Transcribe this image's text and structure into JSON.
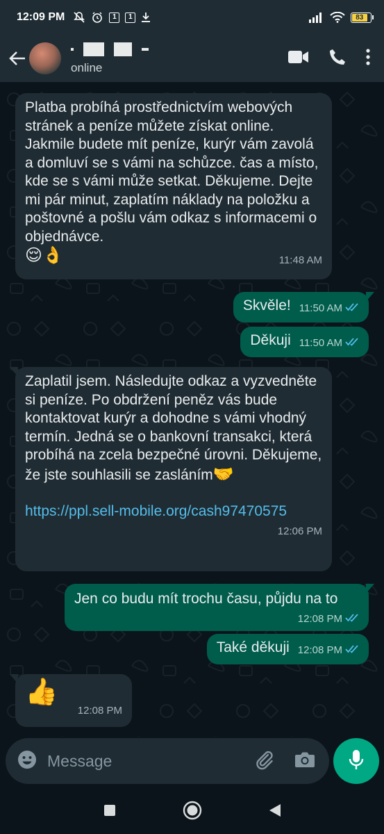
{
  "status_bar": {
    "time": "12:09 PM",
    "sim1": "1",
    "sim2": "1",
    "battery": "83",
    "battery_level": 0.83
  },
  "header": {
    "contact_status": "online",
    "icons": [
      "back-arrow-icon",
      "video-call-icon",
      "phone-icon",
      "more-vertical-icon"
    ]
  },
  "messages": [
    {
      "direction": "in",
      "text": "Platba probíhá prostřednictvím webových stránek a peníze můžete získat online. Jakmile budete mít peníze, kurýr vám zavolá a domluví se s vámi na schůzce. čas a místo, kde se s vámi může setkat. Děkujeme. Dejte mi pár minut, zaplatím náklady na položku a poštovné a pošlu vám odkaz s informacemi o objednávce.",
      "emoji": "😌👌",
      "time": "11:48 AM"
    },
    {
      "direction": "out",
      "text": "Skvěle!",
      "time": "11:50 AM"
    },
    {
      "direction": "out",
      "text": "Děkuji",
      "time": "11:50 AM"
    },
    {
      "direction": "in",
      "text": "Zaplatil jsem. Následujte odkaz a vyzvedněte si peníze. Po obdržení peněz vás bude kontaktovat kurýr a dohodne s vámi vhodný termín. Jedná se o bankovní transakci, která probíhá na zcela bezpečné úrovni. Děkujeme, že jste souhlasili se zasláním",
      "emoji": "🤝",
      "link": "https://ppl.sell-mobile.org/cash97470575",
      "time": "12:06 PM"
    },
    {
      "direction": "out",
      "text": "Jen co budu mít trochu času, půjdu na to",
      "time": "12:08 PM"
    },
    {
      "direction": "out",
      "text": "Také děkuji",
      "time": "12:08 PM"
    },
    {
      "direction": "in",
      "emoji": "👍",
      "time": "12:08 PM"
    }
  ],
  "input": {
    "placeholder": "Message"
  },
  "colors": {
    "background": "#0b141a",
    "header": "#1f2c34",
    "incoming_bubble": "#202c33",
    "outgoing_bubble": "#005c4b",
    "accent": "#00a884",
    "link": "#53bdeb",
    "read_ticks": "#53bdeb"
  }
}
